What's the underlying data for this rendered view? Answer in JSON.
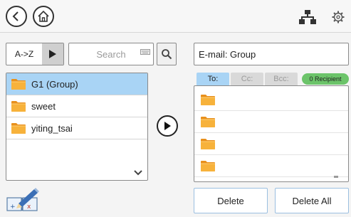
{
  "topbar": {
    "back_icon": "circle-back-arrow-icon",
    "home_icon": "circle-home-icon",
    "network_icon": "network-hierarchy-icon",
    "settings_icon": "gear-icon"
  },
  "sort": {
    "label": "A->Z"
  },
  "search": {
    "placeholder": "Search",
    "value": ""
  },
  "contacts": {
    "items": [
      {
        "label": "G1 (Group)",
        "selected": true
      },
      {
        "label": "sweet",
        "selected": false
      },
      {
        "label": "yiting_tsai",
        "selected": false
      }
    ]
  },
  "email": {
    "label": "E-mail: Group"
  },
  "tabs": [
    {
      "label": "To:",
      "active": true
    },
    {
      "label": "Cc:",
      "active": false
    },
    {
      "label": "Bcc:",
      "active": false
    }
  ],
  "recipients": {
    "count_label": "0 Recipient",
    "row_count": 4
  },
  "buttons": {
    "delete": "Delete",
    "delete_all": "Delete All"
  },
  "colors": {
    "selection": "#a9d4f5",
    "badge": "#6cc46a",
    "folder": "#f5a623"
  }
}
